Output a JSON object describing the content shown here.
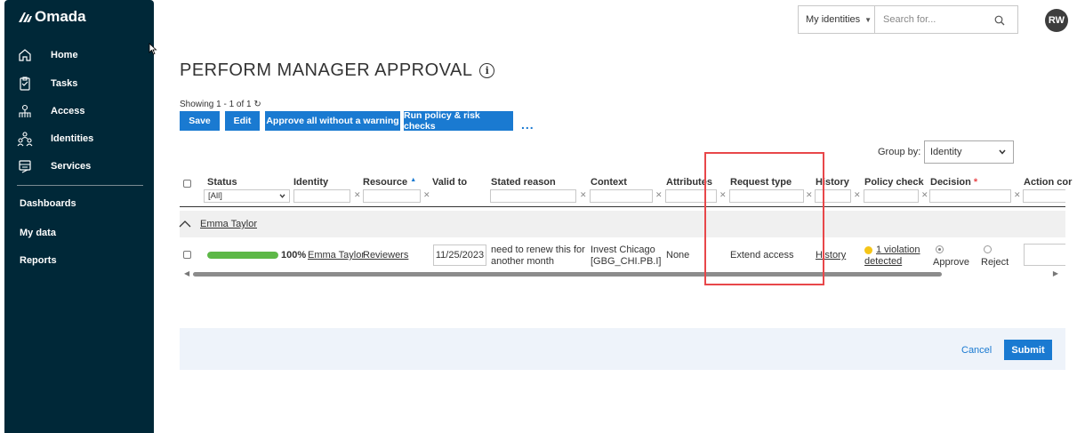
{
  "app": {
    "brand": "Omada"
  },
  "sidebar": {
    "items": [
      {
        "label": "Home",
        "icon": "home-icon"
      },
      {
        "label": "Tasks",
        "icon": "clipboard-icon"
      },
      {
        "label": "Access",
        "icon": "access-icon"
      },
      {
        "label": "Identities",
        "icon": "identities-icon"
      },
      {
        "label": "Services",
        "icon": "services-icon"
      }
    ],
    "plain_items": [
      "Dashboards",
      "My data",
      "Reports"
    ]
  },
  "topbar": {
    "scope_select": "My identities",
    "search_placeholder": "Search for...",
    "avatar_initials": "RW"
  },
  "page": {
    "title": "PERFORM MANAGER APPROVAL",
    "showing": "Showing 1 - 1 of 1",
    "refresh_glyph": "↻"
  },
  "toolbar": {
    "save": "Save",
    "edit": "Edit",
    "approve_all": "Approve all without a warning",
    "run_checks": "Run policy & risk checks",
    "more": "..."
  },
  "group_by": {
    "label": "Group by:",
    "value": "Identity"
  },
  "table": {
    "headers": {
      "status": "Status",
      "identity": "Identity",
      "resource": "Resource",
      "resource_sort": "▲",
      "valid_to": "Valid to",
      "stated_reason": "Stated reason",
      "context": "Context",
      "attributes": "Attributes",
      "request_type": "Request type",
      "history": "History",
      "policy_check": "Policy check",
      "decision": "Decision",
      "decision_required": "*",
      "action_col": "Action cor"
    },
    "status_filter": "[All]",
    "group_name": "Emma Taylor",
    "row": {
      "progress_pct": 100,
      "progress_label": "100%",
      "identity": "Emma Taylor",
      "resource": "Reviewers",
      "valid_to": "11/25/2023",
      "reason_line1": "need to renew this for",
      "reason_line2": "another month",
      "context_line1": "Invest Chicago",
      "context_line2": "[GBG_CHI.PB.I]",
      "attributes": "None",
      "request_type": "Extend access",
      "history": "History",
      "policy_line1": "1 violation",
      "policy_line2": "detected",
      "approve": "Approve",
      "reject": "Reject"
    }
  },
  "footer": {
    "cancel": "Cancel",
    "submit": "Submit"
  },
  "colors": {
    "sidebar_bg": "#002838",
    "accent": "#1a7ad1",
    "progress": "#5db847",
    "highlight": "#e8474a",
    "warning_dot": "#f5c518"
  }
}
